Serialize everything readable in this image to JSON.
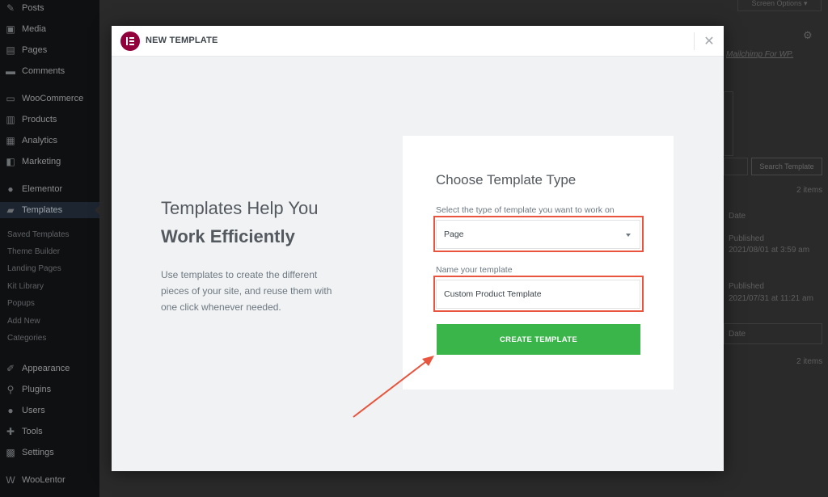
{
  "wp_menu": [
    {
      "label": "Posts",
      "icon": "pin-icon"
    },
    {
      "label": "Media",
      "icon": "media-icon"
    },
    {
      "label": "Pages",
      "icon": "pages-icon"
    },
    {
      "label": "Comments",
      "icon": "comments-icon"
    },
    {
      "label": "WooCommerce",
      "icon": "woocommerce-icon"
    },
    {
      "label": "Products",
      "icon": "products-icon"
    },
    {
      "label": "Analytics",
      "icon": "analytics-icon"
    },
    {
      "label": "Marketing",
      "icon": "marketing-icon"
    },
    {
      "label": "Elementor",
      "icon": "elementor-icon"
    },
    {
      "label": "Templates",
      "icon": "folder-icon"
    },
    {
      "label": "Appearance",
      "icon": "appearance-icon"
    },
    {
      "label": "Plugins",
      "icon": "plugins-icon"
    },
    {
      "label": "Users",
      "icon": "users-icon"
    },
    {
      "label": "Tools",
      "icon": "tools-icon"
    },
    {
      "label": "Settings",
      "icon": "settings-icon"
    },
    {
      "label": "WooLentor",
      "icon": "woolentor-icon"
    }
  ],
  "wp_submenu": [
    "Saved Templates",
    "Theme Builder",
    "Landing Pages",
    "Kit Library",
    "Popups",
    "Add New",
    "Categories"
  ],
  "wp_bg": {
    "screen_options": "Screen Options ▾",
    "plugin_link": "Mailchimp For WP.",
    "search_button": "Search Template",
    "items_count_1": "2 items",
    "col_date": "Date",
    "row1_status": "Published",
    "row1_date": "2021/08/01 at 3:59 am",
    "row2_status": "Published",
    "row2_date": "2021/07/31 at 11:21 am",
    "col_date_footer": "Date",
    "items_count_2": "2 items"
  },
  "modal": {
    "title": "NEW TEMPLATE",
    "close": "✕",
    "intro_title_line1": "Templates Help You",
    "intro_title_line2": "Work Efficiently",
    "intro_description": "Use templates to create the different pieces of your site, and reuse them with one click whenever needed.",
    "form": {
      "title": "Choose Template Type",
      "type_label": "Select the type of template you want to work on",
      "type_value": "Page",
      "name_label": "Name your template",
      "name_value": "Custom Product Template",
      "submit_label": "CREATE TEMPLATE"
    }
  },
  "colors": {
    "accent_green": "#39b54a",
    "highlight_red": "#e8543d",
    "elementor_brand": "#92003b"
  }
}
